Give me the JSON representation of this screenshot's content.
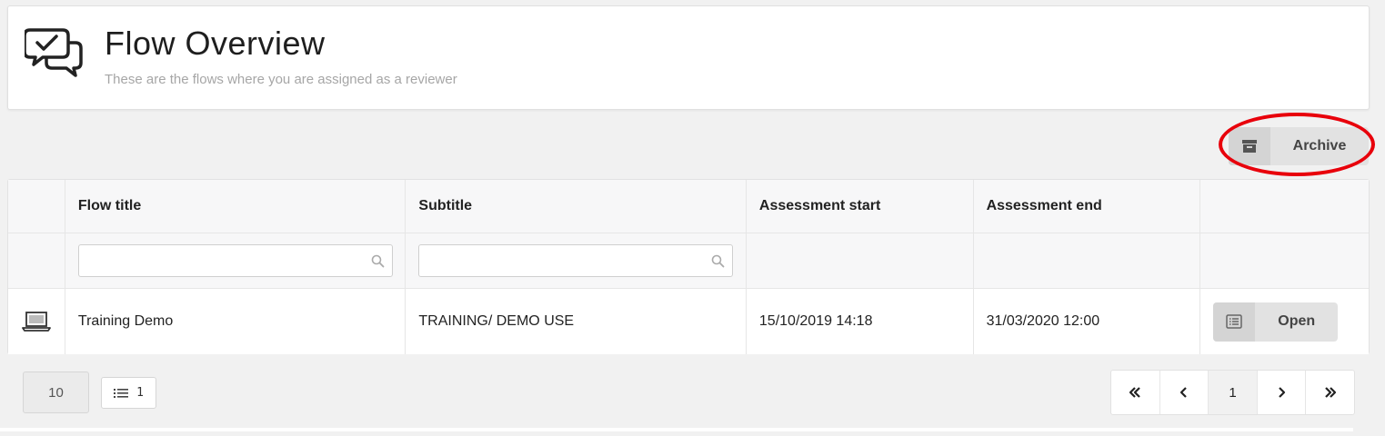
{
  "header": {
    "title": "Flow Overview",
    "subtitle": "These are the flows where you are assigned as a reviewer",
    "icon": "chat-check-icon"
  },
  "toolbar": {
    "archive_label": "Archive",
    "archive_icon": "archive-box-icon",
    "highlight_color": "#e8000b"
  },
  "table": {
    "columns": [
      "",
      "Flow title",
      "Subtitle",
      "Assessment start",
      "Assessment end",
      ""
    ],
    "filters": {
      "flow_title": {
        "value": "",
        "placeholder": ""
      },
      "subtitle": {
        "value": "",
        "placeholder": ""
      }
    },
    "rows": [
      {
        "icon": "laptop-icon",
        "flow_title": "Training Demo",
        "subtitle": "TRAINING/ DEMO USE",
        "assessment_start": "15/10/2019 14:18",
        "assessment_end": "31/03/2020 12:00",
        "action_label": "Open",
        "action_icon": "list-icon"
      }
    ]
  },
  "footer": {
    "page_size": "10",
    "total_count": "1",
    "pagination": {
      "first": "«",
      "prev": "‹",
      "current": "1",
      "next": "›",
      "last": "»"
    }
  }
}
